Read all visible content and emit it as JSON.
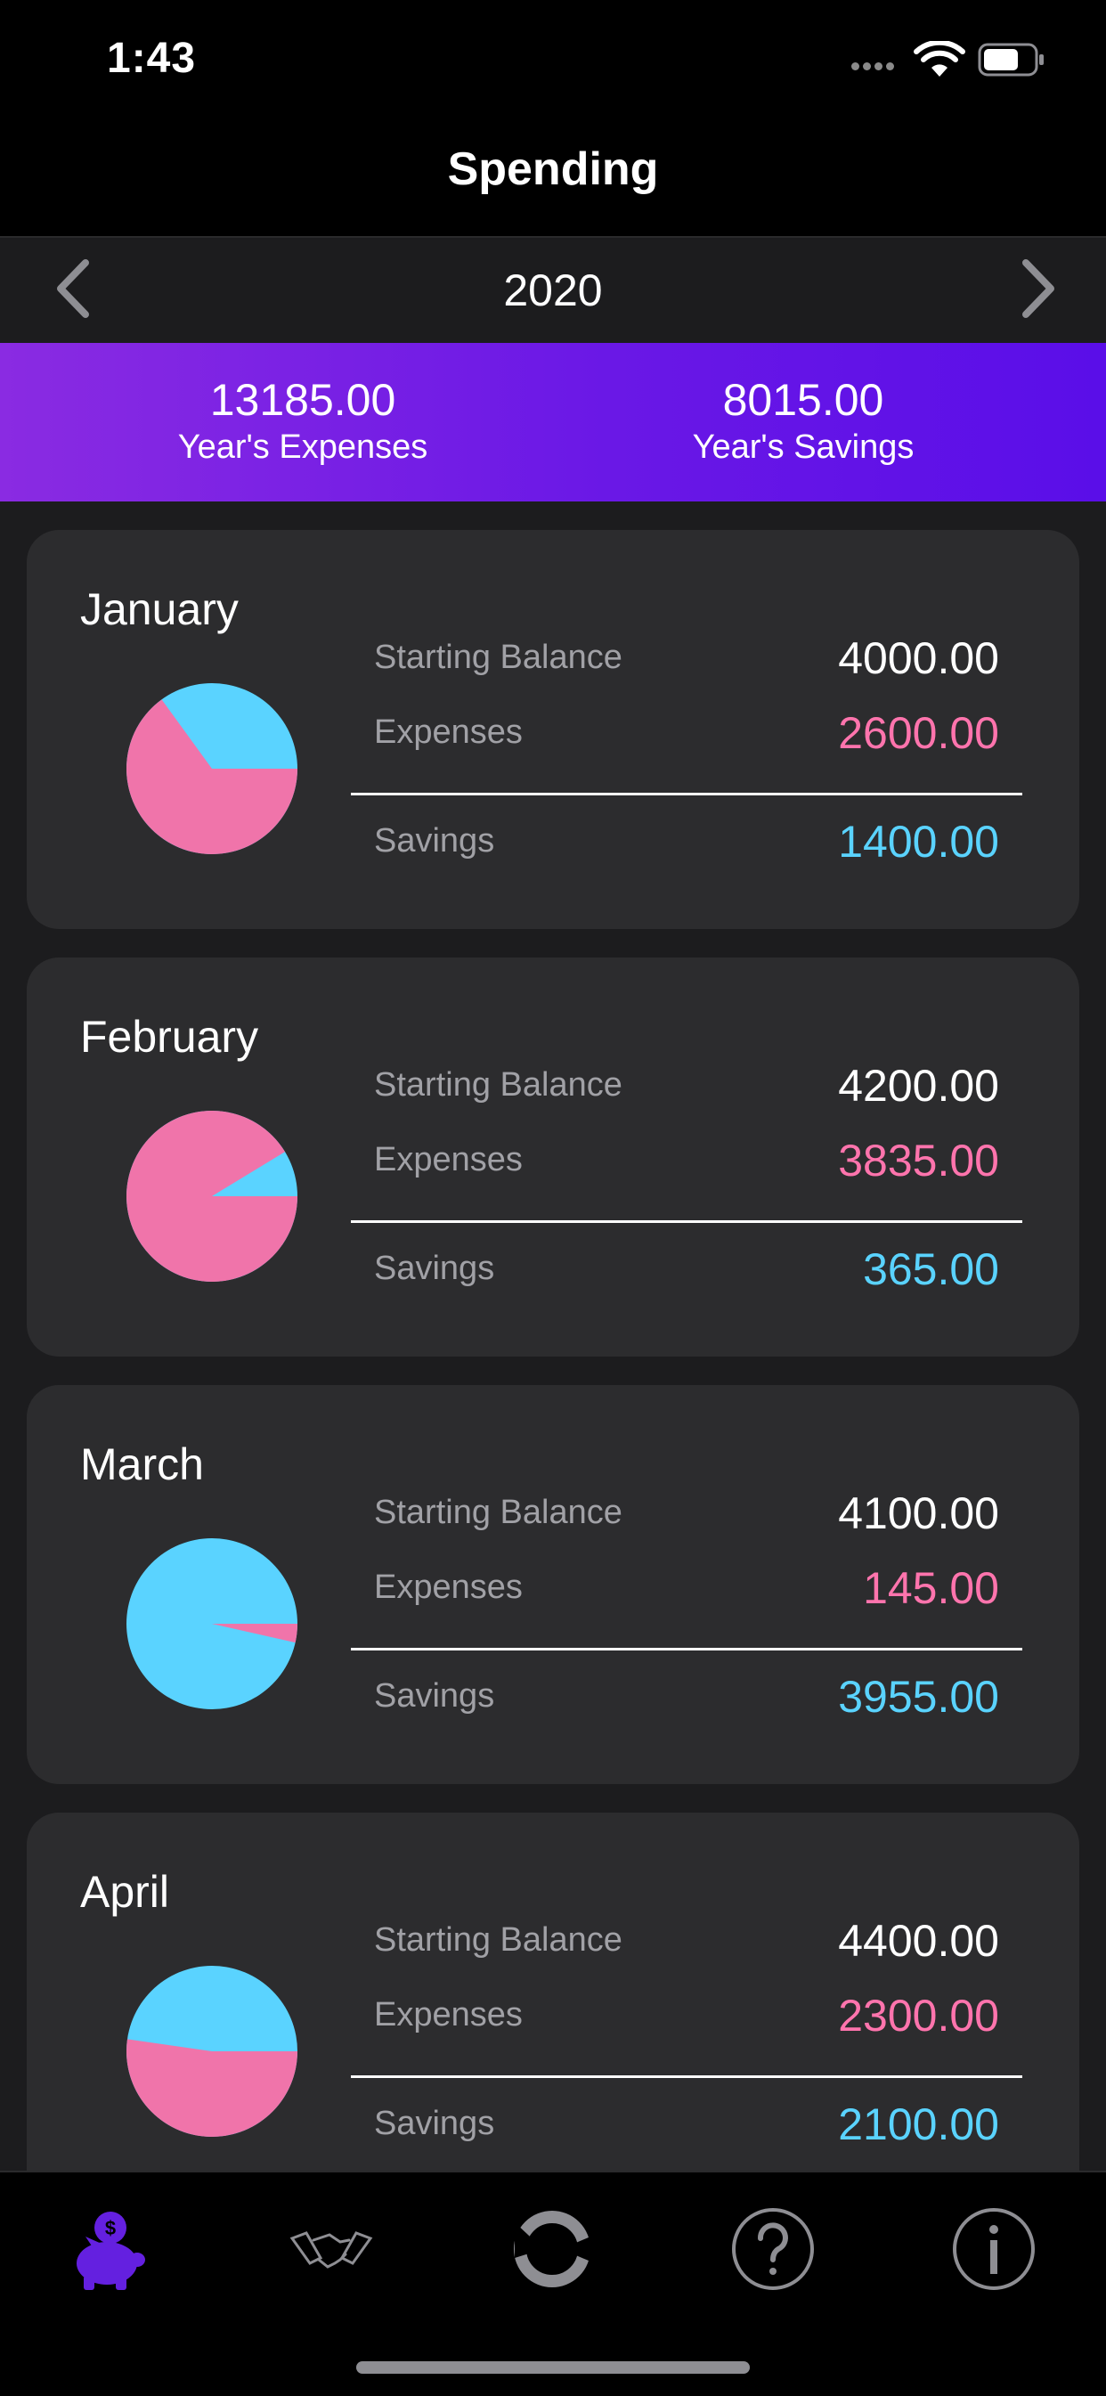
{
  "status": {
    "time": "1:43"
  },
  "header": {
    "title": "Spending"
  },
  "year_selector": {
    "year": "2020"
  },
  "summary": {
    "expenses_value": "13185.00",
    "expenses_label": "Year's Expenses",
    "savings_value": "8015.00",
    "savings_label": "Year's Savings"
  },
  "labels": {
    "starting_balance": "Starting Balance",
    "expenses": "Expenses",
    "savings": "Savings"
  },
  "colors": {
    "expenses": "#f074aa",
    "savings": "#5ad3ff",
    "accent_start": "#8a2be2",
    "accent_end": "#5a0ee8"
  },
  "months": [
    {
      "name": "January",
      "starting_balance": "4000.00",
      "expenses": "2600.00",
      "savings": "1400.00"
    },
    {
      "name": "February",
      "starting_balance": "4200.00",
      "expenses": "3835.00",
      "savings": "365.00"
    },
    {
      "name": "March",
      "starting_balance": "4100.00",
      "expenses": "145.00",
      "savings": "3955.00"
    },
    {
      "name": "April",
      "starting_balance": "4400.00",
      "expenses": "2300.00",
      "savings": "2100.00"
    }
  ],
  "tabs": [
    "piggy-bank-icon",
    "handshake-icon",
    "refresh-icon",
    "help-icon",
    "info-icon"
  ]
}
